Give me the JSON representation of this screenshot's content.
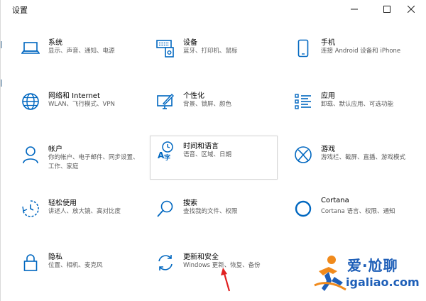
{
  "window": {
    "title": "设置"
  },
  "accent": "#0067c0",
  "tiles": [
    {
      "key": "system",
      "name": "系统",
      "desc": "显示、声音、通知、电源",
      "icon": "laptop-icon"
    },
    {
      "key": "devices",
      "name": "设备",
      "desc": "蓝牙、打印机、鼠标",
      "icon": "keyboard-icon"
    },
    {
      "key": "phone",
      "name": "手机",
      "desc": "连接 Android 设备和 iPhone",
      "icon": "phone-icon"
    },
    {
      "key": "network",
      "name": "网络和 Internet",
      "desc": "WLAN、飞行模式、VPN",
      "icon": "globe-icon"
    },
    {
      "key": "personalization",
      "name": "个性化",
      "desc": "背景、锁屏、颜色",
      "icon": "paint-icon"
    },
    {
      "key": "apps",
      "name": "应用",
      "desc": "卸载、默认应用、可选功能",
      "icon": "apps-list-icon"
    },
    {
      "key": "accounts",
      "name": "帐户",
      "desc": "你的帐户、电子邮件、同步设置、工作、家庭",
      "icon": "person-icon"
    },
    {
      "key": "time-language",
      "name": "时间和语言",
      "desc": "语音、区域、日期",
      "icon": "time-language-icon"
    },
    {
      "key": "gaming",
      "name": "游戏",
      "desc": "游戏栏、截屏、直播、游戏模式",
      "icon": "xbox-icon"
    },
    {
      "key": "ease-of-access",
      "name": "轻松使用",
      "desc": "讲述人、放大镜、高对比度",
      "icon": "ease-access-icon"
    },
    {
      "key": "search",
      "name": "搜索",
      "desc": "查找我的文件、权限",
      "icon": "search-icon"
    },
    {
      "key": "cortana",
      "name": "Cortana",
      "desc": "Cortana 语言、权限、通知",
      "icon": "cortana-icon"
    },
    {
      "key": "privacy",
      "name": "隐私",
      "desc": "位置、相机、麦克风",
      "icon": "lock-icon"
    },
    {
      "key": "update-security",
      "name": "更新和安全",
      "desc": "Windows 更新、恢复、备份",
      "icon": "sync-icon"
    }
  ],
  "watermark": {
    "line1": "爱·尬聊",
    "line2": "igaliao.com"
  }
}
